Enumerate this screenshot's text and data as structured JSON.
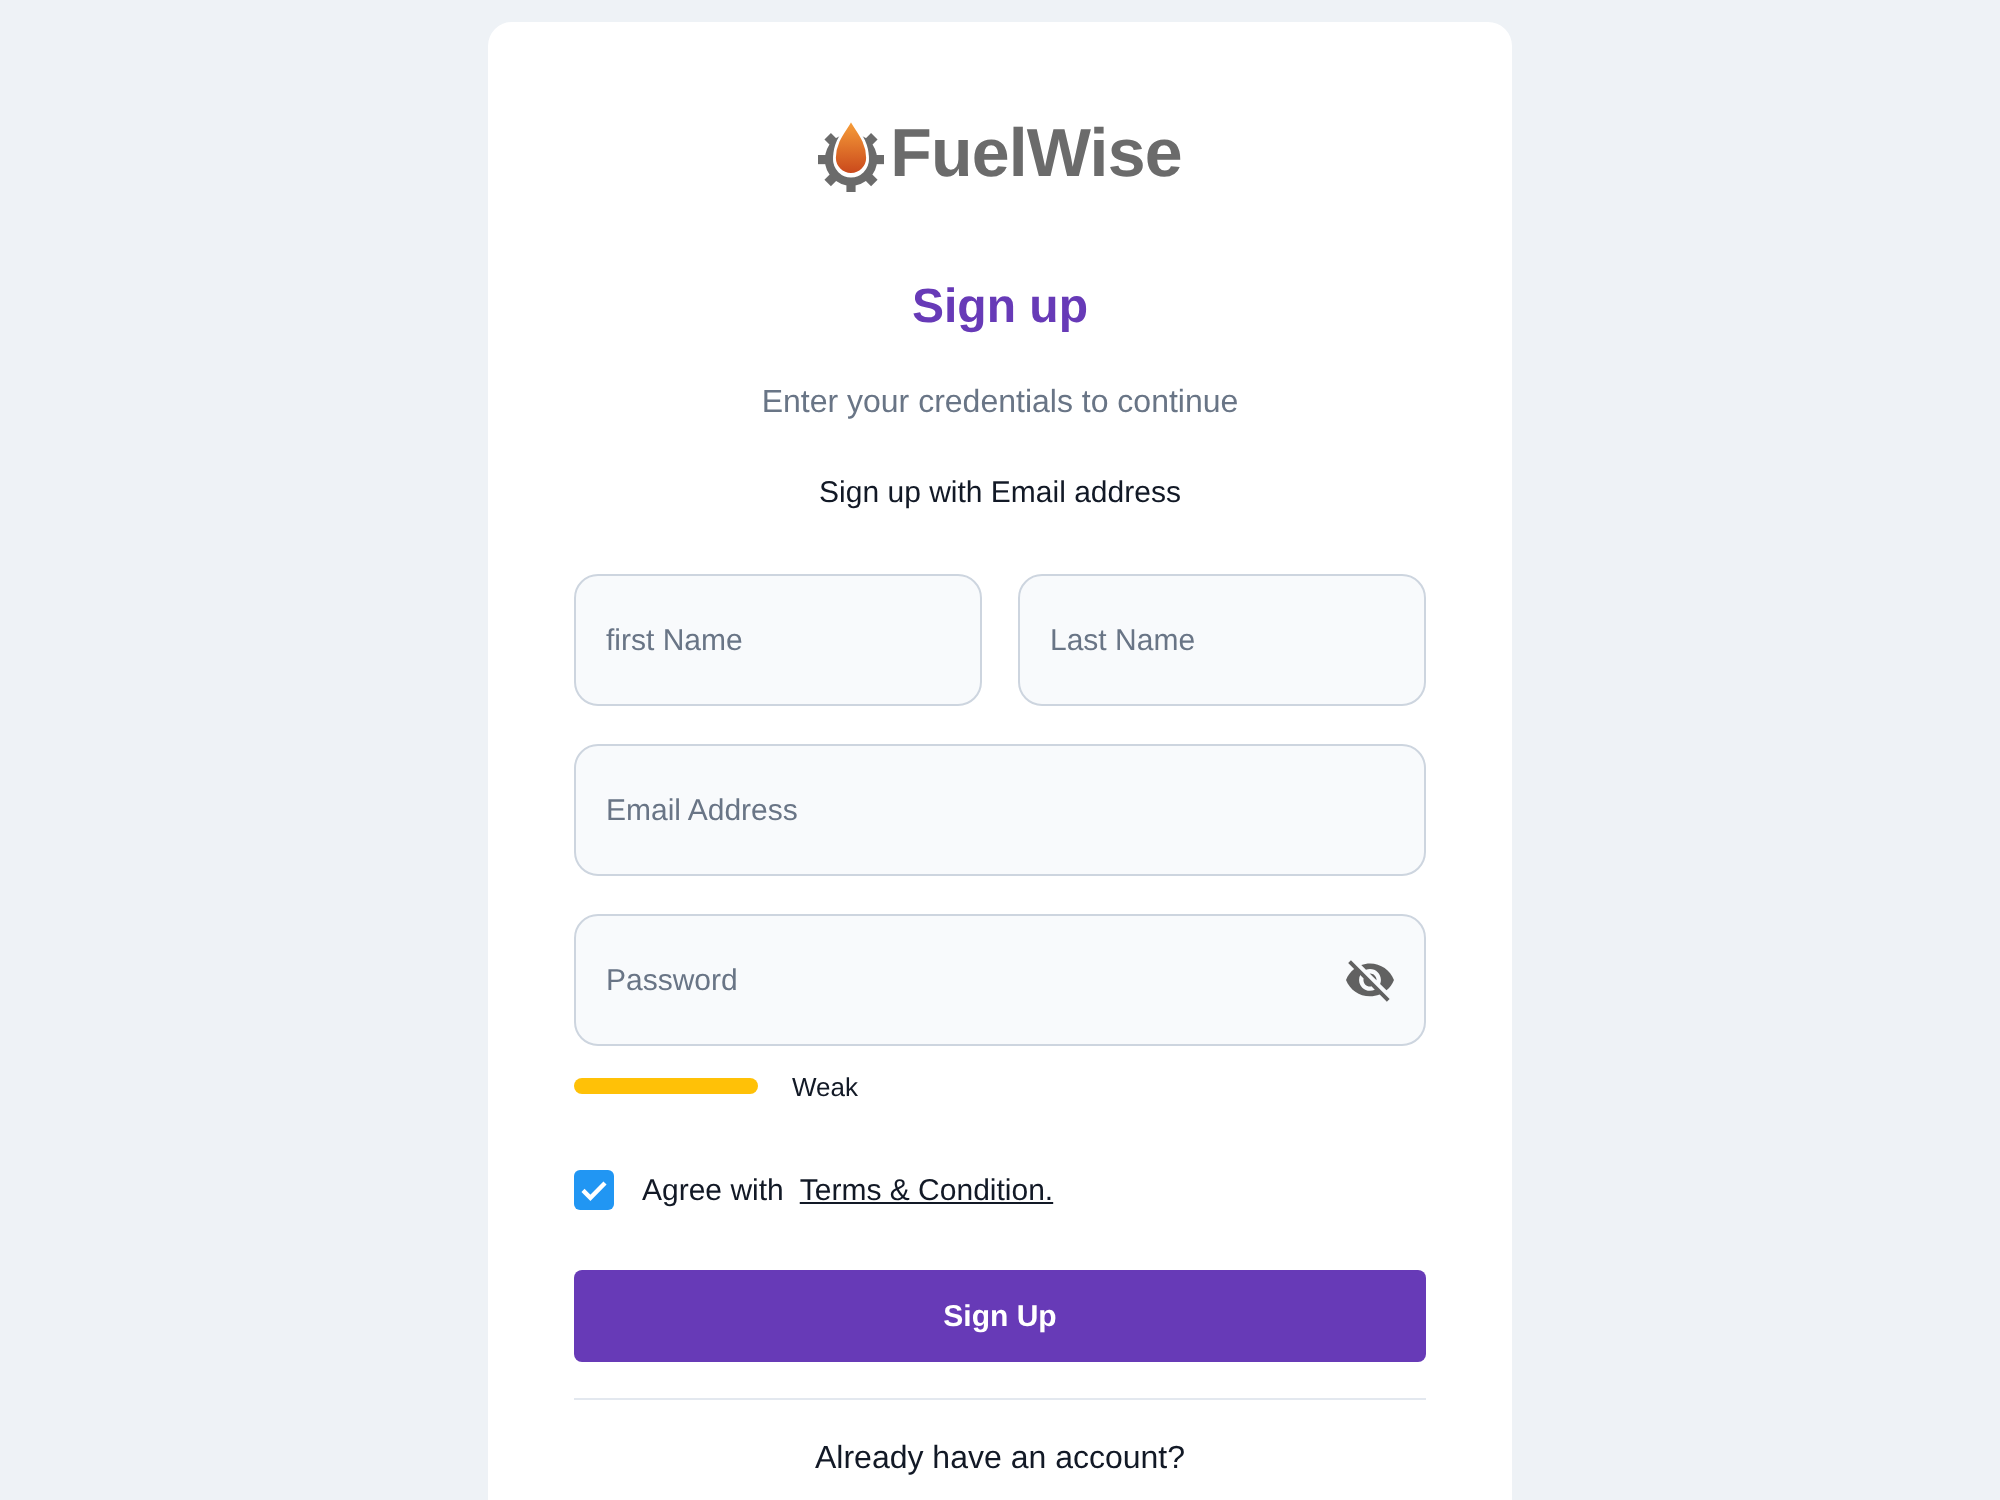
{
  "logo": {
    "text": "FuelWise"
  },
  "heading": "Sign up",
  "subtitle": "Enter your credentials to continue",
  "method_label": "Sign up with Email address",
  "name_fields": [
    {
      "placeholder": "first Name"
    },
    {
      "placeholder": "Last Name"
    }
  ],
  "email_field": {
    "placeholder": "Email Address"
  },
  "password_field": {
    "placeholder": "Password",
    "show_password": false
  },
  "password_strength": {
    "label": "Weak",
    "color": "#ffc107"
  },
  "agree": {
    "checked": true,
    "label": "Agree with",
    "link": "Terms & Condition."
  },
  "submit_button": "Sign Up",
  "footer_link": "Already have an account?"
}
